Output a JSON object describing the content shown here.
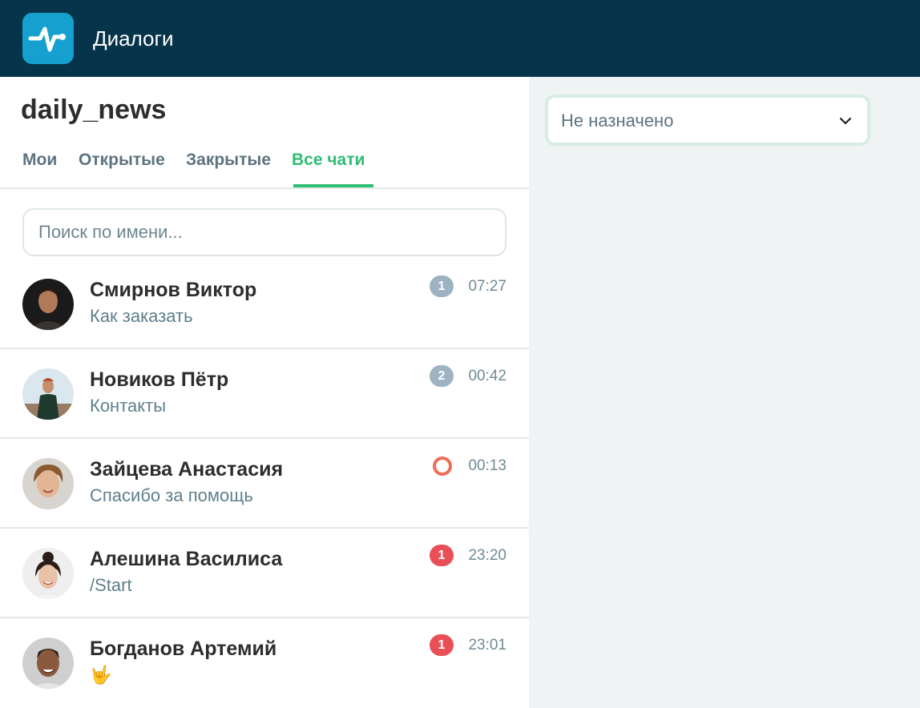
{
  "header": {
    "logo_icon": "pulse-logo-icon",
    "title": "Диалоги",
    "bg_color": "#06344a",
    "logo_color": "#16a0cf"
  },
  "channel": {
    "name": "daily_news"
  },
  "tabs": [
    {
      "label": "Мои",
      "active": false
    },
    {
      "label": "Открытые",
      "active": false
    },
    {
      "label": "Закрытые",
      "active": false
    },
    {
      "label": "Все чати",
      "active": true
    }
  ],
  "accent_color": "#2fbd74",
  "search": {
    "placeholder": "Поиск по имени...",
    "value": ""
  },
  "chats": [
    {
      "name": "Смирнов Виктор",
      "preview": "Как заказать",
      "badge": "1",
      "badge_type": "grey",
      "time": "07:27"
    },
    {
      "name": "Новиков Пётр",
      "preview": "Контакты",
      "badge": "2",
      "badge_type": "grey",
      "time": "00:42"
    },
    {
      "name": "Зайцева Анастасия",
      "preview": "Спасибо за помощь",
      "badge": "",
      "badge_type": "ring",
      "time": "00:13"
    },
    {
      "name": "Алешина Василиса",
      "preview": "/Start",
      "badge": "1",
      "badge_type": "red",
      "time": "23:20"
    },
    {
      "name": "Богданов Артемий",
      "preview": "🤟",
      "badge": "1",
      "badge_type": "red",
      "time": "23:01"
    }
  ],
  "assignee": {
    "selected": "Не назначено",
    "icon": "chevron-down-icon"
  }
}
